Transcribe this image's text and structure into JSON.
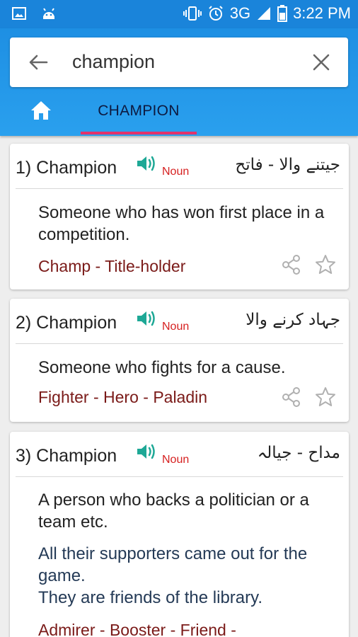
{
  "status_bar": {
    "network": "3G",
    "time": "3:22 PM"
  },
  "search": {
    "query": "champion"
  },
  "tab": {
    "label": "CHAMPION"
  },
  "colors": {
    "primary": "#1a84da",
    "accent": "#e2336b",
    "pos": "#d62020",
    "synonym": "#7a1a18",
    "speaker": "#1ea896"
  },
  "entries": [
    {
      "index_word": "1) Champion",
      "pos": "Noun",
      "urdu": "جیتنے والا - فاتح",
      "definition": "Someone who has won first place in a competition.",
      "synonyms": "Champ - Title-holder"
    },
    {
      "index_word": "2) Champion",
      "pos": "Noun",
      "urdu": "جہاد کرنے والا",
      "definition": "Someone who fights for a cause.",
      "synonyms": "Fighter - Hero - Paladin"
    },
    {
      "index_word": "3) Champion",
      "pos": "Noun",
      "urdu": "مداح - جیالہ",
      "definition": "A person who backs a politician or a team etc.",
      "example1": "All their supporters came out for the game.",
      "example2": "They are friends of the library.",
      "synonyms": "Admirer - Booster - Friend -"
    }
  ]
}
